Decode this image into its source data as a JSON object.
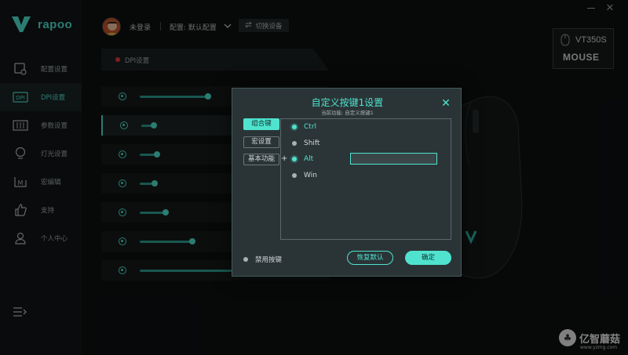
{
  "brand": {
    "name": "rapoo",
    "accent": "#4fe3cf"
  },
  "topbar": {
    "login_status": "未登录",
    "profile": "配置: 默认配置",
    "switch_device": "切换设备"
  },
  "device": {
    "name": "VT350S",
    "type": "MOUSE"
  },
  "sidebar": {
    "items": [
      {
        "label": "配置设置",
        "icon": "config-icon"
      },
      {
        "label": "DPI设置",
        "icon": "dpi-icon",
        "active": true
      },
      {
        "label": "参数设置",
        "icon": "params-icon"
      },
      {
        "label": "灯光设置",
        "icon": "bulb-icon"
      },
      {
        "label": "宏编辑",
        "icon": "macro-icon"
      },
      {
        "label": "支持",
        "icon": "thumbs-up-icon"
      },
      {
        "label": "个人中心",
        "icon": "user-icon"
      }
    ]
  },
  "dpi_panel": {
    "title": "DPI设置",
    "rows": [
      {
        "level": 0.5,
        "active": false
      },
      {
        "level": 0.08,
        "active": true
      },
      {
        "level": 0.12,
        "active": false
      },
      {
        "level": 0.1,
        "active": false
      },
      {
        "level": 0.18,
        "active": false
      },
      {
        "level": 0.38,
        "active": false
      },
      {
        "level": 0.9,
        "active": false
      }
    ]
  },
  "modal": {
    "title": "自定义按键1设置",
    "subtitle": "当前功能: 自定义按键1",
    "tabs": [
      {
        "label": "组合键",
        "active": true
      },
      {
        "label": "宏设置",
        "active": false
      },
      {
        "label": "基本功能",
        "active": false
      }
    ],
    "modifiers": [
      {
        "label": "Ctrl",
        "checked": true
      },
      {
        "label": "Shift",
        "checked": false
      },
      {
        "label": "Alt",
        "checked": true
      },
      {
        "label": "Win",
        "checked": false
      }
    ],
    "plus": "+",
    "combo_value": "",
    "disable_label": "禁用按键",
    "reset_label": "恢复默认",
    "ok_label": "确定"
  },
  "watermark": {
    "text": "亿智蘑菇",
    "url": "www.yzmg.com"
  }
}
